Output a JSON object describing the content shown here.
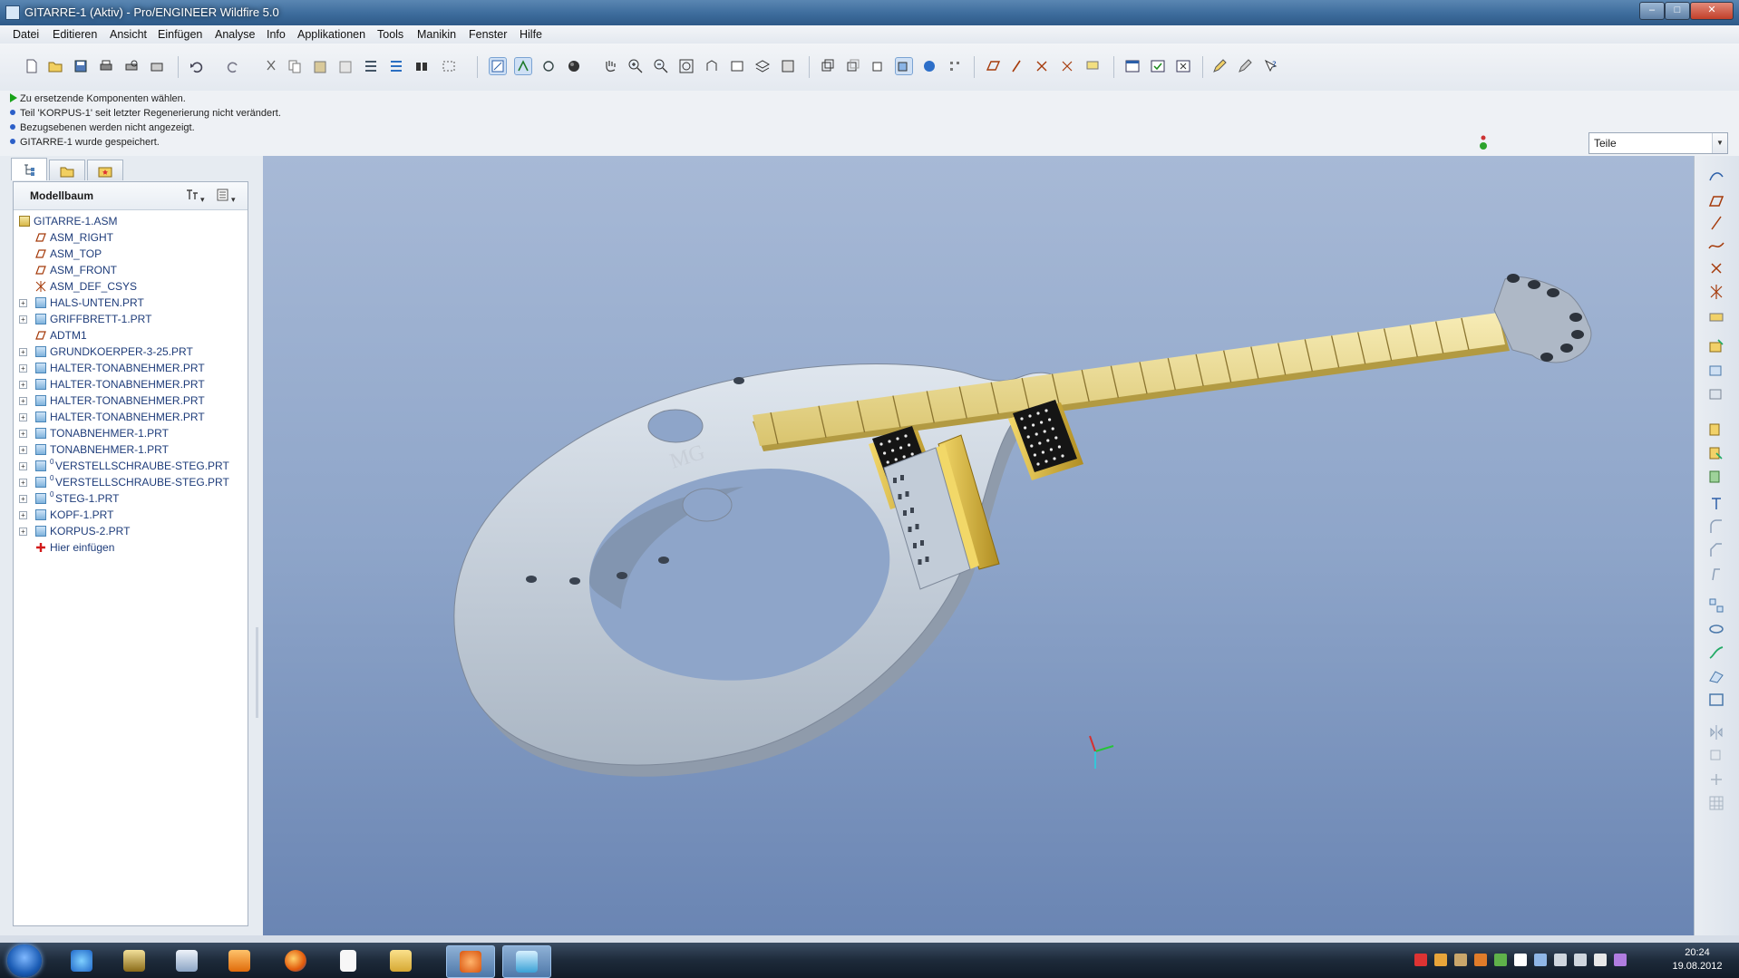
{
  "window": {
    "title": "GITARRE-1 (Aktiv) - Pro/ENGINEER Wildfire 5.0",
    "minimize": "–",
    "maximize": "□",
    "close": "✕"
  },
  "menu": [
    "Datei",
    "Editieren",
    "Ansicht",
    "Einfügen",
    "Analyse",
    "Info",
    "Applikationen",
    "Tools",
    "Manikin",
    "Fenster",
    "Hilfe"
  ],
  "messages": [
    "Zu ersetzende Komponenten wählen.",
    "Teil 'KORPUS-1' seit letzter Regenerierung nicht verändert.",
    "Bezugsebenen werden nicht angezeigt.",
    "GITARRE-1 wurde gespeichert."
  ],
  "filter": {
    "value": "Teile"
  },
  "model_tree": {
    "title": "Modellbaum",
    "items": [
      {
        "label": "GITARRE-1.ASM",
        "icon": "assembly-icon",
        "expandable": false,
        "root": true
      },
      {
        "label": "ASM_RIGHT",
        "icon": "datum-plane-icon",
        "expandable": false
      },
      {
        "label": "ASM_TOP",
        "icon": "datum-plane-icon",
        "expandable": false
      },
      {
        "label": "ASM_FRONT",
        "icon": "datum-plane-icon",
        "expandable": false
      },
      {
        "label": "ASM_DEF_CSYS",
        "icon": "coordinate-system-icon",
        "expandable": false
      },
      {
        "label": "HALS-UNTEN.PRT",
        "icon": "part-icon",
        "expandable": true
      },
      {
        "label": "GRIFFBRETT-1.PRT",
        "icon": "part-icon",
        "expandable": true
      },
      {
        "label": "ADTM1",
        "icon": "datum-plane-icon",
        "expandable": false
      },
      {
        "label": "GRUNDKOERPER-3-25.PRT",
        "icon": "part-icon",
        "expandable": true
      },
      {
        "label": "HALTER-TONABNEHMER.PRT",
        "icon": "part-icon",
        "expandable": true
      },
      {
        "label": "HALTER-TONABNEHMER.PRT",
        "icon": "part-icon",
        "expandable": true
      },
      {
        "label": "HALTER-TONABNEHMER.PRT",
        "icon": "part-icon",
        "expandable": true
      },
      {
        "label": "HALTER-TONABNEHMER.PRT",
        "icon": "part-icon",
        "expandable": true
      },
      {
        "label": "TONABNEHMER-1.PRT",
        "icon": "part-icon",
        "expandable": true
      },
      {
        "label": "TONABNEHMER-1.PRT",
        "icon": "part-icon",
        "expandable": true
      },
      {
        "label": "VERSTELLSCHRAUBE-STEG.PRT",
        "icon": "part-icon",
        "expandable": true,
        "marker": "0"
      },
      {
        "label": "VERSTELLSCHRAUBE-STEG.PRT",
        "icon": "part-icon",
        "expandable": true,
        "marker": "0"
      },
      {
        "label": "STEG-1.PRT",
        "icon": "part-icon",
        "expandable": true,
        "marker": "0"
      },
      {
        "label": "KOPF-1.PRT",
        "icon": "part-icon",
        "expandable": true
      },
      {
        "label": "KORPUS-2.PRT",
        "icon": "part-icon",
        "expandable": true
      },
      {
        "label": "Hier einfügen",
        "icon": "insert-here-icon",
        "expandable": false
      }
    ]
  },
  "model": {
    "body_text": "MG"
  },
  "taskbar": {
    "clock_time": "20:24",
    "clock_date": "19.08.2012"
  },
  "colors": {
    "viewport_top": "#a7b9d6",
    "viewport_bottom": "#6a85b3",
    "body_gray": "#c9d3de",
    "fretboard": "#efe2a0",
    "pickup": "#141414",
    "gold": "#d8b342"
  }
}
